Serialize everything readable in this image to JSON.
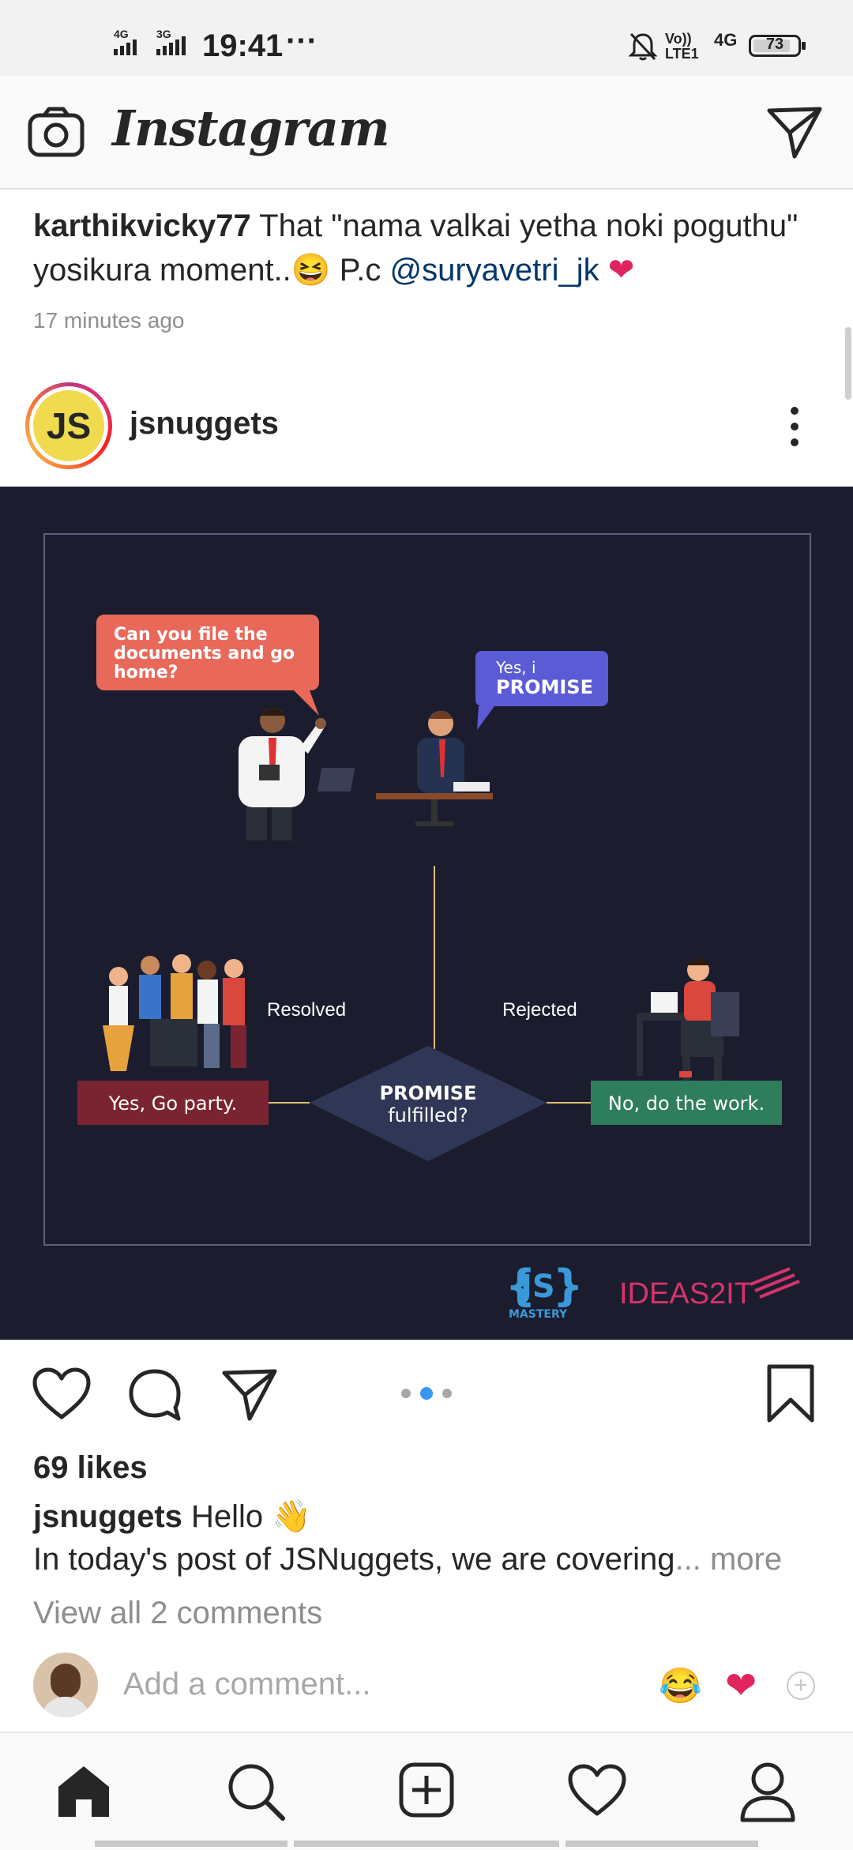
{
  "status_bar": {
    "network_left_1": "4G",
    "network_left_2": "3G",
    "time": "19:41",
    "dots": "···",
    "volte": "Vo)) LTE1",
    "network_right": "4G",
    "battery": "73"
  },
  "header": {
    "app_title": "Instagram"
  },
  "previous_post": {
    "username": "karthikvicky77",
    "caption_line1": " That \"nama valkai yetha noki poguthu\"",
    "caption_line2": "yosikura moment..",
    "caption_emoji": "😆",
    "caption_pc": " P.c ",
    "mention": "@suryavetri_jk",
    "heart": "❤",
    "time_ago": "17 minutes ago"
  },
  "post": {
    "avatar_text": "JS",
    "username": "jsnuggets",
    "image": {
      "bubble_left": [
        "Can you file the",
        "documents and go",
        "home?"
      ],
      "bubble_right_small": "Yes, i",
      "bubble_right_big": "PROMISE",
      "label_resolved": "Resolved",
      "label_rejected": "Rejected",
      "diamond_line1": "PROMISE",
      "diamond_line2": "fulfilled?",
      "box_left": "Yes, Go party.",
      "box_right": "No, do the work.",
      "brand_js": "JS",
      "brand_js_sub": "MASTERY",
      "brand_ideas": "IDEAS2IT"
    },
    "likes": "69 likes",
    "caption_username": "jsnuggets",
    "caption_text": " Hello ",
    "caption_emoji": "👋",
    "caption_line2": "In today's post of JSNuggets, we are covering",
    "more": "... more",
    "view_comments": "View all 2 comments",
    "add_comment_placeholder": "Add a comment...",
    "quick_emoji_1": "😂",
    "quick_emoji_2": "❤",
    "quick_add": "+"
  },
  "colors": {
    "accent_blue": "#3897f0",
    "image_bg": "#1b1d2e",
    "coral": "#e8695a",
    "purple": "#5b5bd6",
    "maroon": "#7b2431",
    "green": "#2e7d5b",
    "diamond": "#2f3656"
  }
}
